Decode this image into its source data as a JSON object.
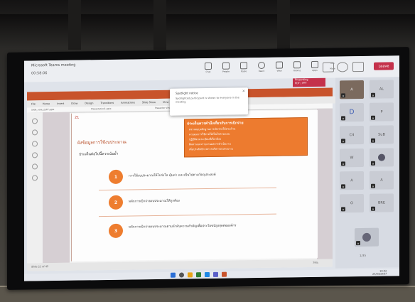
{
  "colors": {
    "teams_leave": "#c4314b",
    "accent_orange": "#ee7d2f",
    "ppt_titlebar": "#c8532b",
    "screen_bg": "#dfe3ea"
  },
  "teams": {
    "title": "Microsoft Teams meeting",
    "elapsed": "00:58:06",
    "toolbar": [
      {
        "icon": "chat-icon",
        "label": "Chat"
      },
      {
        "icon": "people-icon",
        "label": "People"
      },
      {
        "icon": "raise-hand-icon",
        "label": "Raise"
      },
      {
        "icon": "react-icon",
        "label": "React"
      },
      {
        "icon": "view-icon",
        "label": "View"
      },
      {
        "icon": "rooms-icon",
        "label": "Rooms"
      },
      {
        "icon": "apps-icon",
        "label": "Apps"
      },
      {
        "icon": "more-icon",
        "label": "More"
      }
    ],
    "leave_label": "Leave"
  },
  "notification": {
    "title": "Spotlight notice",
    "body": "Spotlighted participant is shown to everyone in the meeting",
    "close": "×"
  },
  "presenter_badge": {
    "line1": "Presenting",
    "line2": "PDF | PPT"
  },
  "powerpoint": {
    "menu": [
      "File",
      "Home",
      "Insert",
      "Draw",
      "Design",
      "Transitions",
      "Animations",
      "Slide Show",
      "View"
    ],
    "tabs": [
      "Slide_note_2567.pptx",
      "Presentation1.pptx",
      "Presenter View",
      "Notes"
    ],
    "status_left": "Slide 21 of 45",
    "status_right": "79%",
    "slide": {
      "number": "21",
      "title": "ผังข้อมูลการใช้งบประมาณ",
      "subtitle": "ประเด็นต่อไปนี้ควรเน้นย้ำ",
      "box_heading": "ประเด็นควรคำนึงเกี่ยวกับการเบิกจ่าย",
      "box_lines": [
        "ตรวจสอบหลักฐานการเบิกจ่ายให้ครบถ้วน",
        "ควบคุมการใช้จ่ายให้เป็นไปตามแผน",
        "ปฏิบัติตามระเบียบที่เกี่ยวข้อง",
        "ติดตามและรายงานผลการดำเนินงาน",
        "เพิ่มประสิทธิภาพการบริหารงบประมาณ"
      ],
      "points": [
        {
          "n": "1",
          "text": "การใช้งบประมาณให้โปร่งใส คุ้มค่า และเป็นไปตามวัตถุประสงค์"
        },
        {
          "n": "2",
          "text": "หลักการเบิกจ่ายงบประมาณให้ถูกต้อง"
        },
        {
          "n": "3",
          "text": "หลักการเบิกจ่ายงบประมาณตามลำดับความสำคัญเพื่อประโยชน์สูงสุดต่อองค์กร"
        }
      ]
    }
  },
  "gallery": {
    "tiles": [
      "A",
      "AL",
      "D",
      "P",
      "C4",
      "SuB",
      "W",
      "A",
      "A",
      "O",
      "BRE"
    ],
    "pager": "1/35"
  },
  "taskbar": {
    "time": "10:02",
    "date": "25/03/2567"
  }
}
